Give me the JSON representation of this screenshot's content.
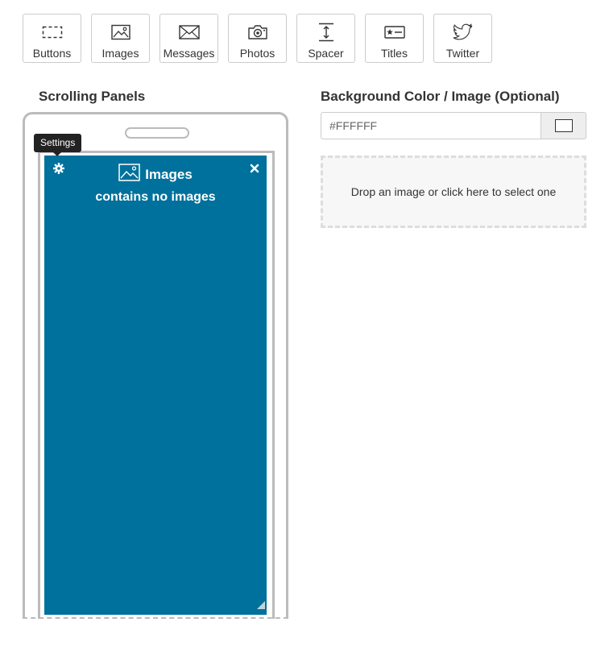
{
  "toolbar": {
    "items": [
      {
        "label": "Buttons",
        "icon": "dashed-rectangle-icon"
      },
      {
        "label": "Images",
        "icon": "image-icon"
      },
      {
        "label": "Messages",
        "icon": "envelope-icon"
      },
      {
        "label": "Photos",
        "icon": "camera-icon"
      },
      {
        "label": "Spacer",
        "icon": "vertical-spacer-icon"
      },
      {
        "label": "Titles",
        "icon": "title-card-icon"
      },
      {
        "label": "Twitter",
        "icon": "twitter-bird-icon"
      }
    ]
  },
  "scrolling_panels": {
    "heading": "Scrolling Panels",
    "tooltip": "Settings",
    "panel": {
      "title": "Images",
      "empty_message": "contains no images",
      "background_color": "#00719c"
    }
  },
  "background": {
    "heading": "Background Color / Image (Optional)",
    "color_placeholder": "#FFFFFF",
    "swatch_color": "#FFFFFF",
    "dropzone_text": "Drop an image or click here to select one"
  }
}
